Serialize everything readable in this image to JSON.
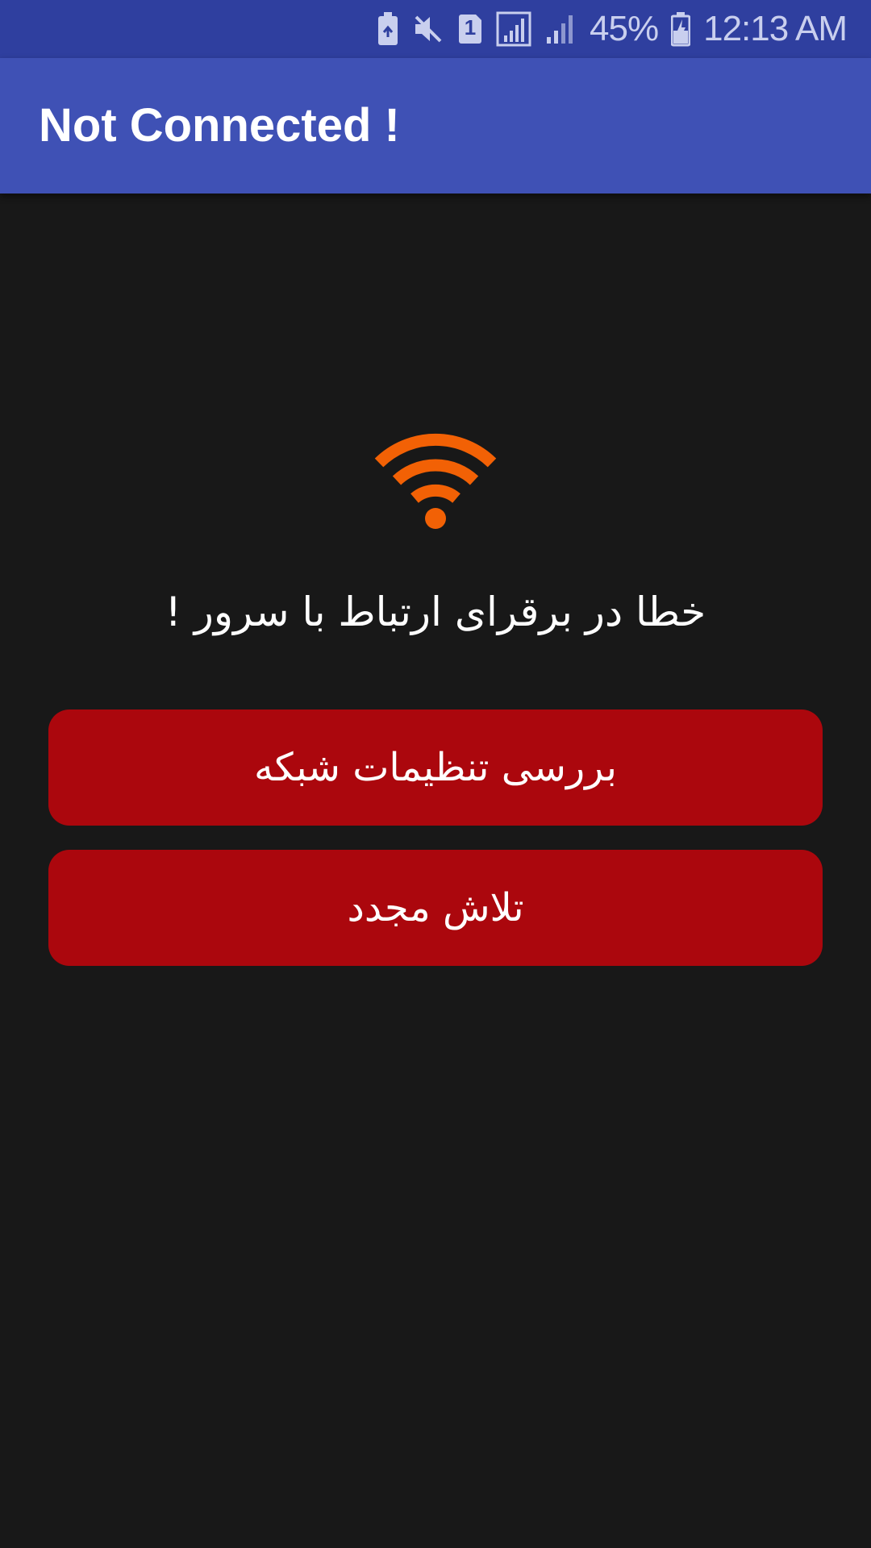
{
  "status_bar": {
    "battery_percent": "45%",
    "time": "12:13 AM",
    "sim_label": "1",
    "icons": [
      "battery-saver-icon",
      "mute-icon",
      "sim-icon",
      "signal-icon",
      "signal-icon",
      "battery-charging-icon"
    ]
  },
  "app_bar": {
    "title": "Not Connected !"
  },
  "main": {
    "icon": "wifi-icon",
    "icon_color": "#f26105",
    "error_message": "خطا در برقرای ارتباط با سرور !",
    "buttons": {
      "network_settings": "بررسی تنظیمات شبکه",
      "retry": "تلاش مجدد"
    },
    "button_color": "#ab070d"
  }
}
